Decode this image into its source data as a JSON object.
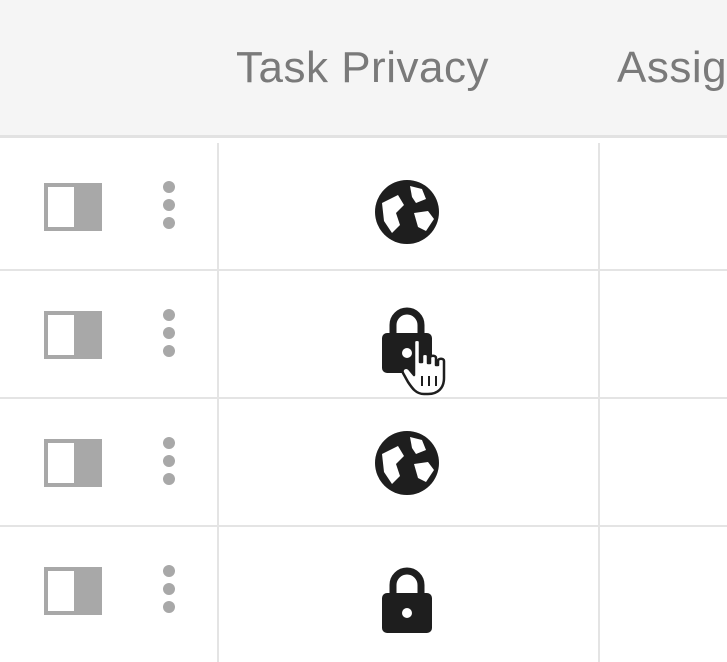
{
  "table": {
    "columns": {
      "privacy": "Task Privacy",
      "assignee": "Assig"
    },
    "rows": [
      {
        "privacy": "public",
        "privacy_icon": "globe-icon"
      },
      {
        "privacy": "private",
        "privacy_icon": "lock-icon"
      },
      {
        "privacy": "public",
        "privacy_icon": "globe-icon"
      },
      {
        "privacy": "private",
        "privacy_icon": "lock-icon"
      }
    ]
  },
  "colors": {
    "header_bg": "#f5f5f5",
    "header_text": "#7a7a7a",
    "border": "#e4e4e4",
    "icon": "#1e1e1e",
    "checkbox": "#a8a8a8"
  }
}
